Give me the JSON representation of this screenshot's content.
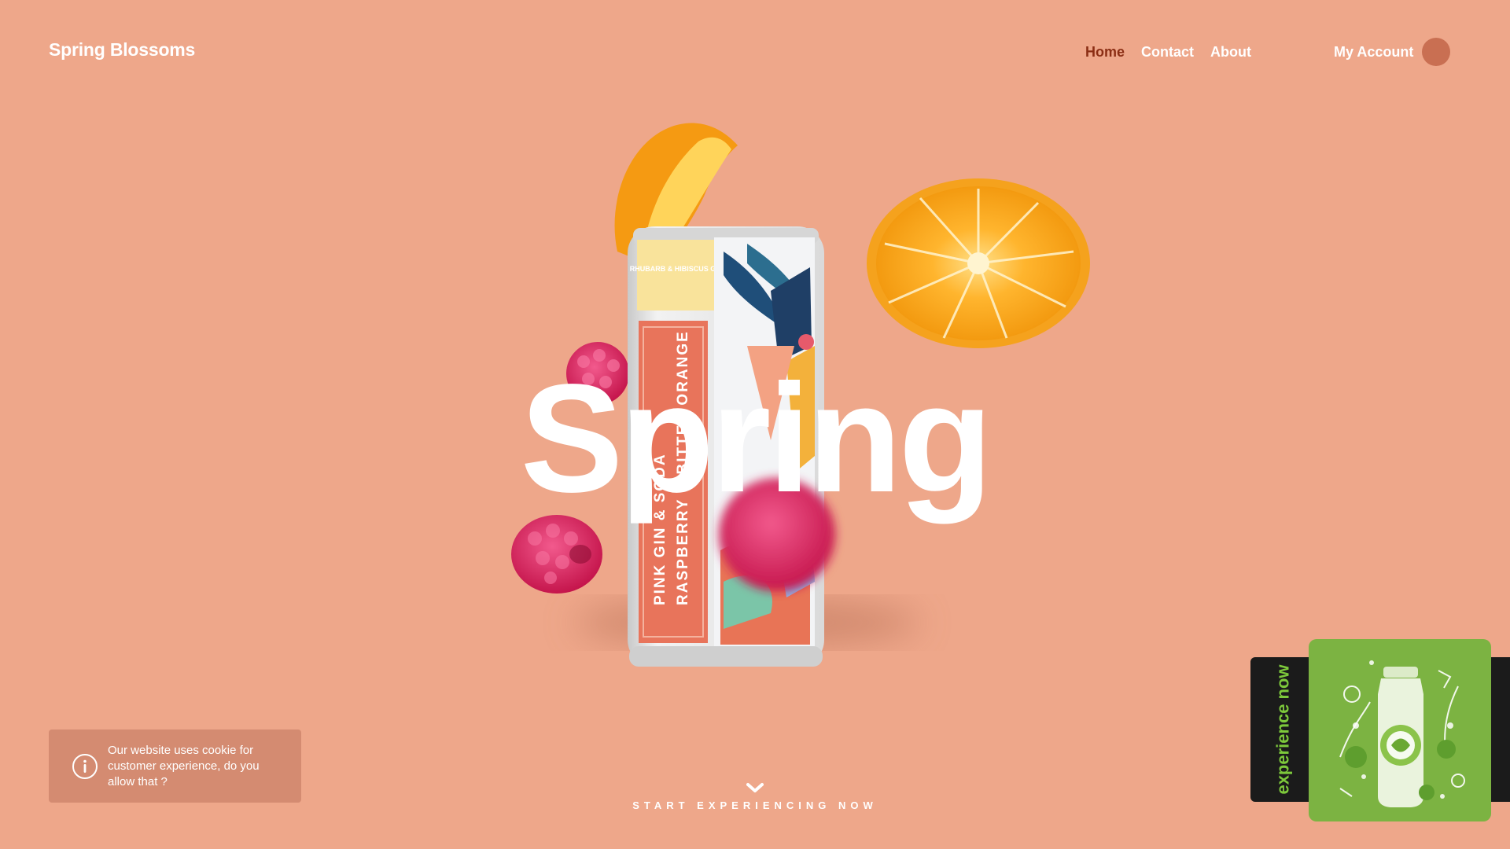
{
  "header": {
    "logo": "Spring Blossoms",
    "nav": [
      {
        "label": "Home",
        "active": true
      },
      {
        "label": "Contact",
        "active": false
      },
      {
        "label": "About",
        "active": false
      }
    ],
    "account_label": "My Account"
  },
  "hero": {
    "headline": "Spring",
    "can_text": {
      "side_top": "RHUBARB & HIBISCUS GIN",
      "side_main_1": "PINK GIN & SODA",
      "side_main_2": "RASPBERRY & BITTER ORANGE"
    }
  },
  "cookie": {
    "message": "Our website uses cookie for customer experience, do you allow that ?"
  },
  "scroll_cta": {
    "label": "START EXPERIENCING NOW"
  },
  "promo": {
    "label": "experience now"
  },
  "colors": {
    "background": "#EEA78A",
    "nav_active": "#8B2E14",
    "promo_green": "#7CB342",
    "promo_label": "#7DC93B"
  }
}
